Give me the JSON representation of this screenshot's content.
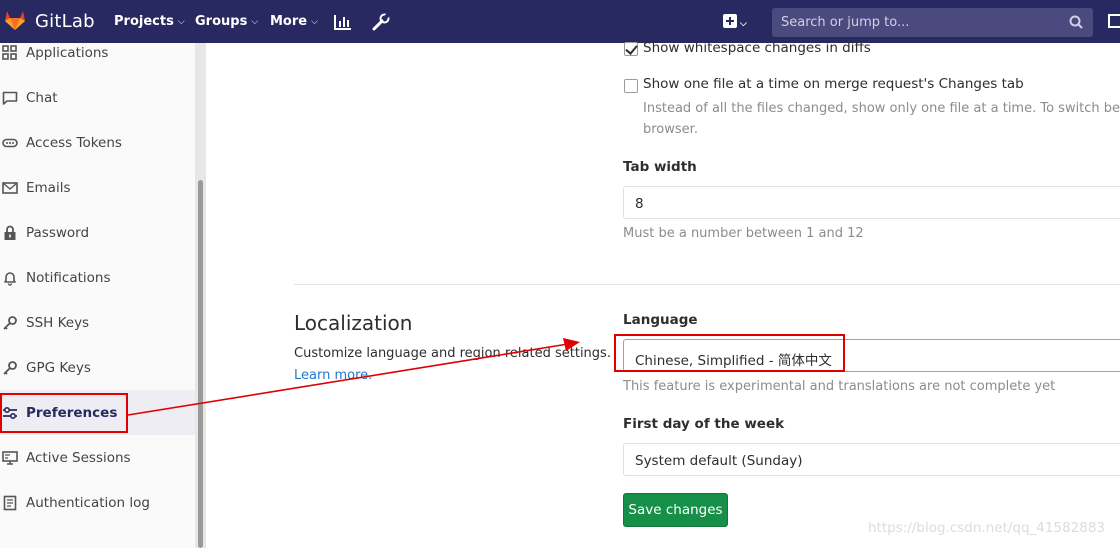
{
  "navbar": {
    "brand": "GitLab",
    "projects": "Projects",
    "groups": "Groups",
    "more": "More",
    "search_placeholder": "Search or jump to..."
  },
  "sidebar": {
    "items": [
      {
        "label": "Applications",
        "icon": "applications-icon"
      },
      {
        "label": "Chat",
        "icon": "chat-icon"
      },
      {
        "label": "Access Tokens",
        "icon": "token-icon"
      },
      {
        "label": "Emails",
        "icon": "mail-icon"
      },
      {
        "label": "Password",
        "icon": "lock-icon"
      },
      {
        "label": "Notifications",
        "icon": "bell-icon"
      },
      {
        "label": "SSH Keys",
        "icon": "key-icon"
      },
      {
        "label": "GPG Keys",
        "icon": "key-icon"
      },
      {
        "label": "Preferences",
        "icon": "preferences-icon",
        "active": true
      },
      {
        "label": "Active Sessions",
        "icon": "monitor-icon"
      },
      {
        "label": "Authentication log",
        "icon": "log-icon"
      }
    ]
  },
  "behavior": {
    "show_whitespace_label": "Show whitespace changes in diffs",
    "show_whitespace_checked": true,
    "one_file_label": "Show one file at a time on merge request's Changes tab",
    "one_file_checked": false,
    "one_file_help_line1": "Instead of all the files changed, show only one file at a time. To switch betwee",
    "one_file_help_line2": "browser.",
    "tab_width_label": "Tab width",
    "tab_width_value": "8",
    "tab_width_help": "Must be a number between 1 and 12"
  },
  "localization": {
    "title": "Localization",
    "description": "Customize language and region related settings.",
    "learn_more": "Learn more.",
    "language_label": "Language",
    "language_value": "Chinese, Simplified - 简体中文",
    "language_help": "This feature is experimental and translations are not complete yet",
    "first_day_label": "First day of the week",
    "first_day_value": "System default (Sunday)",
    "save_button": "Save changes"
  },
  "watermark": "https://blog.csdn.net/qq_41582883",
  "colors": {
    "navbar": "#292961",
    "save_button": "#168f48",
    "annotation": "#e00000",
    "link": "#1f78d1"
  }
}
